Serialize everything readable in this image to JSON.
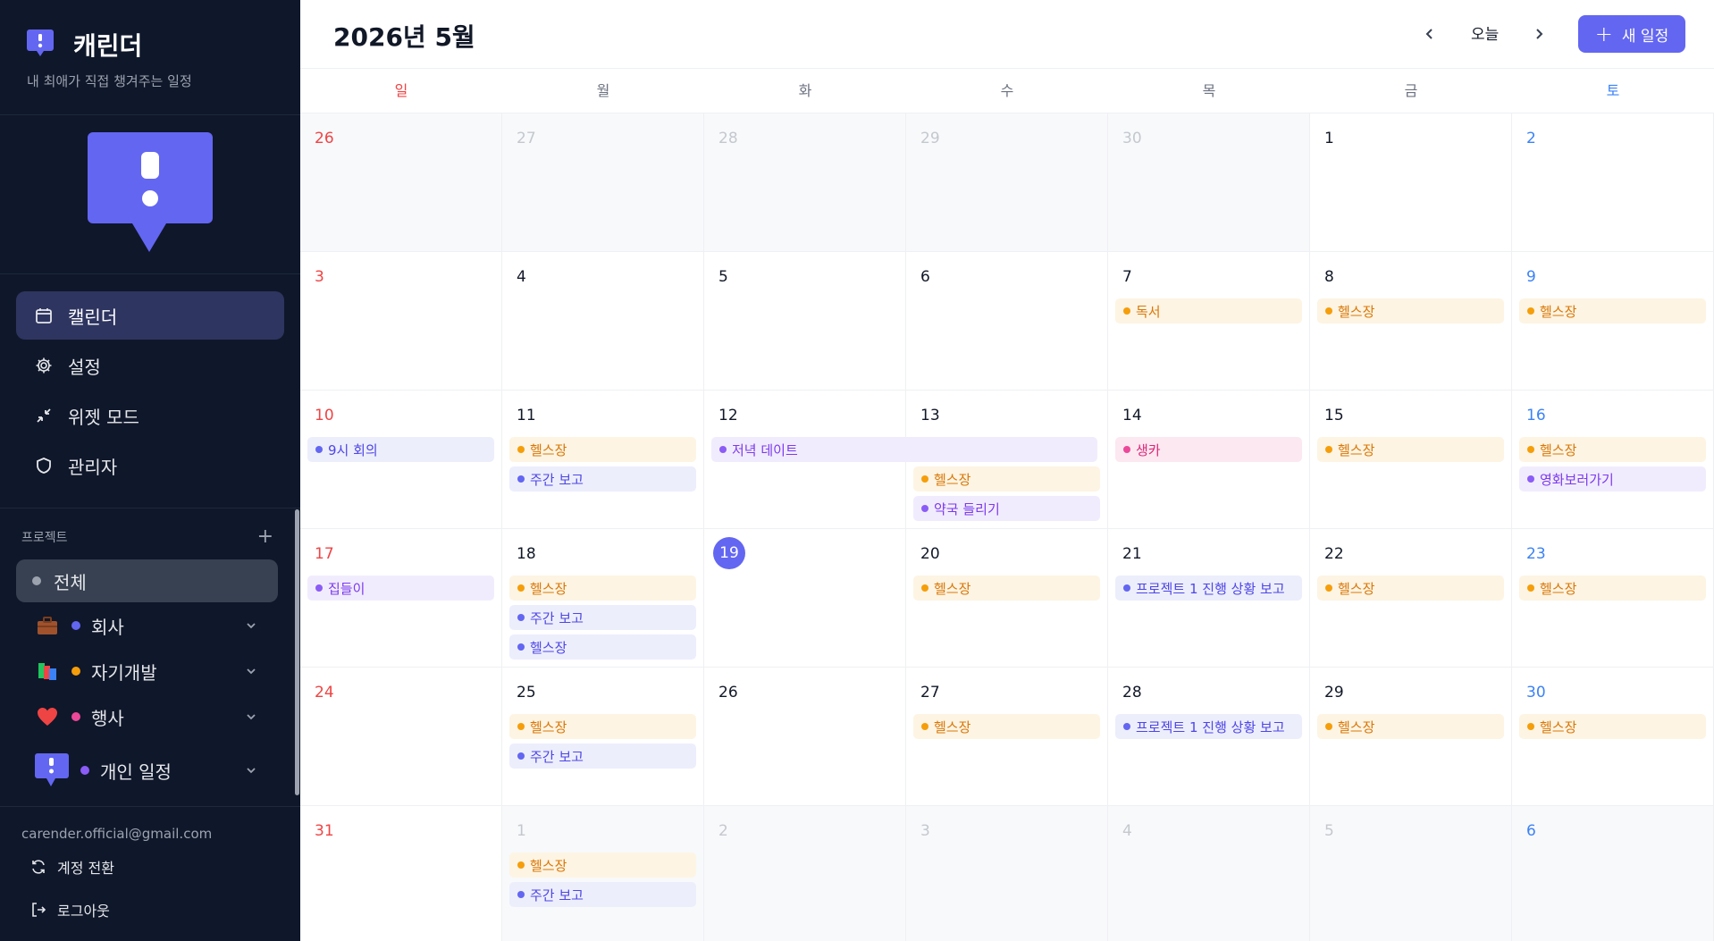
{
  "app": {
    "title": "캐린더",
    "subtitle": "내 최애가 직접 챙겨주는 일정",
    "accent": "#6366f1"
  },
  "sidebar": {
    "nav": [
      {
        "label": "캘린더",
        "icon": "calendar-icon",
        "active": true
      },
      {
        "label": "설정",
        "icon": "gear-icon",
        "active": false
      },
      {
        "label": "위젯 모드",
        "icon": "minimize-icon",
        "active": false
      },
      {
        "label": "관리자",
        "icon": "shield-icon",
        "active": false
      }
    ],
    "projects_label": "프로젝트",
    "projects": [
      {
        "label": "전체",
        "dot": "#9ca3af",
        "active": true
      },
      {
        "label": "회사",
        "emoji": "💼",
        "dot": "#6366f1"
      },
      {
        "label": "자기개발",
        "emoji": "📚",
        "dot": "#f59e0b"
      },
      {
        "label": "행사",
        "emoji": "❤️",
        "dot": "#ec4899"
      },
      {
        "label": "개인 일정",
        "icon": "mascot-icon",
        "dot": "#8b5cf6"
      }
    ],
    "email": "carender.official@gmail.com",
    "switch_account": "계정 전환",
    "logout": "로그아웃"
  },
  "header": {
    "month_title": "2026년 5월",
    "today_label": "오늘",
    "new_event_label": "새 일정"
  },
  "weekdays": [
    "일",
    "월",
    "화",
    "수",
    "목",
    "금",
    "토"
  ],
  "calendar": {
    "weeks": [
      [
        {
          "day": "26",
          "out": true,
          "sun": true,
          "events": []
        },
        {
          "day": "27",
          "out": true,
          "events": []
        },
        {
          "day": "28",
          "out": true,
          "events": []
        },
        {
          "day": "29",
          "out": true,
          "events": []
        },
        {
          "day": "30",
          "out": true,
          "events": []
        },
        {
          "day": "1",
          "events": []
        },
        {
          "day": "2",
          "sat": true,
          "events": []
        }
      ],
      [
        {
          "day": "3",
          "sun": true,
          "events": []
        },
        {
          "day": "4",
          "events": []
        },
        {
          "day": "5",
          "events": []
        },
        {
          "day": "6",
          "events": []
        },
        {
          "day": "7",
          "events": [
            {
              "title": "독서",
              "color": "orange"
            }
          ]
        },
        {
          "day": "8",
          "events": [
            {
              "title": "헬스장",
              "color": "orange"
            }
          ]
        },
        {
          "day": "9",
          "sat": true,
          "events": [
            {
              "title": "헬스장",
              "color": "orange"
            }
          ]
        }
      ],
      [
        {
          "day": "10",
          "sun": true,
          "events": [
            {
              "title": "9시 회의",
              "color": "blue"
            }
          ]
        },
        {
          "day": "11",
          "events": [
            {
              "title": "헬스장",
              "color": "orange"
            },
            {
              "title": "주간 보고",
              "color": "blue"
            }
          ]
        },
        {
          "day": "12",
          "events": [
            {
              "title": "저녁 데이트",
              "color": "purple",
              "span": 2
            }
          ]
        },
        {
          "day": "13",
          "events": [
            {
              "title": "",
              "spacer": true
            },
            {
              "title": "헬스장",
              "color": "orange"
            },
            {
              "title": "약국 들리기",
              "color": "purple"
            }
          ]
        },
        {
          "day": "14",
          "events": [
            {
              "title": "생카",
              "color": "pink"
            }
          ]
        },
        {
          "day": "15",
          "events": [
            {
              "title": "헬스장",
              "color": "orange"
            }
          ]
        },
        {
          "day": "16",
          "sat": true,
          "events": [
            {
              "title": "헬스장",
              "color": "orange"
            },
            {
              "title": "영화보러가기",
              "color": "purple"
            }
          ]
        }
      ],
      [
        {
          "day": "17",
          "sun": true,
          "events": [
            {
              "title": "집들이",
              "color": "purple"
            }
          ]
        },
        {
          "day": "18",
          "events": [
            {
              "title": "헬스장",
              "color": "orange"
            },
            {
              "title": "주간 보고",
              "color": "blue"
            },
            {
              "title": "헬스장",
              "color": "blue"
            }
          ]
        },
        {
          "day": "19",
          "today": true,
          "events": []
        },
        {
          "day": "20",
          "events": [
            {
              "title": "헬스장",
              "color": "orange"
            }
          ]
        },
        {
          "day": "21",
          "events": [
            {
              "title": "프로젝트 1 진행 상황 보고",
              "color": "blue"
            }
          ]
        },
        {
          "day": "22",
          "events": [
            {
              "title": "헬스장",
              "color": "orange"
            }
          ]
        },
        {
          "day": "23",
          "sat": true,
          "events": [
            {
              "title": "헬스장",
              "color": "orange"
            }
          ]
        }
      ],
      [
        {
          "day": "24",
          "sun": true,
          "events": []
        },
        {
          "day": "25",
          "events": [
            {
              "title": "헬스장",
              "color": "orange"
            },
            {
              "title": "주간 보고",
              "color": "blue"
            }
          ]
        },
        {
          "day": "26",
          "events": []
        },
        {
          "day": "27",
          "events": [
            {
              "title": "헬스장",
              "color": "orange"
            }
          ]
        },
        {
          "day": "28",
          "events": [
            {
              "title": "프로젝트 1 진행 상황 보고",
              "color": "blue"
            }
          ]
        },
        {
          "day": "29",
          "events": [
            {
              "title": "헬스장",
              "color": "orange"
            }
          ]
        },
        {
          "day": "30",
          "sat": true,
          "events": [
            {
              "title": "헬스장",
              "color": "orange"
            }
          ]
        }
      ],
      [
        {
          "day": "31",
          "sun": true,
          "events": []
        },
        {
          "day": "1",
          "out": true,
          "events": [
            {
              "title": "헬스장",
              "color": "orange"
            },
            {
              "title": "주간 보고",
              "color": "blue"
            }
          ]
        },
        {
          "day": "2",
          "out": true,
          "events": []
        },
        {
          "day": "3",
          "out": true,
          "events": []
        },
        {
          "day": "4",
          "out": true,
          "events": []
        },
        {
          "day": "5",
          "out": true,
          "events": []
        },
        {
          "day": "6",
          "out": true,
          "sat": true,
          "events": []
        }
      ]
    ]
  }
}
